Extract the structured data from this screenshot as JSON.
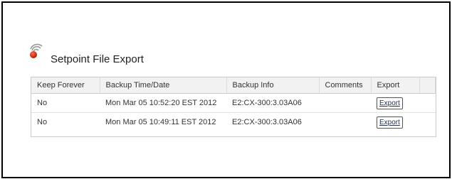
{
  "page": {
    "title": "Setpoint File Export"
  },
  "table": {
    "headers": [
      "Keep Forever",
      "Backup Time/Date",
      "Backup Info",
      "Comments",
      "Export"
    ],
    "rows": [
      {
        "keep_forever": "No",
        "backup_time": "Mon Mar 05 10:52:20 EST 2012",
        "backup_info": "E2:CX-300:3.03A06",
        "comments": "",
        "export_label": "Export"
      },
      {
        "keep_forever": "No",
        "backup_time": "Mon Mar 05 10:49:11 EST 2012",
        "backup_info": "E2:CX-300:3.03A06",
        "comments": "",
        "export_label": "Export"
      }
    ]
  },
  "icons": {
    "logo": "wireless-signal-red-dot-icon"
  },
  "colors": {
    "logo_dot": "#cc2200",
    "border": "#000000",
    "header_bg": "#f2f2f2"
  }
}
